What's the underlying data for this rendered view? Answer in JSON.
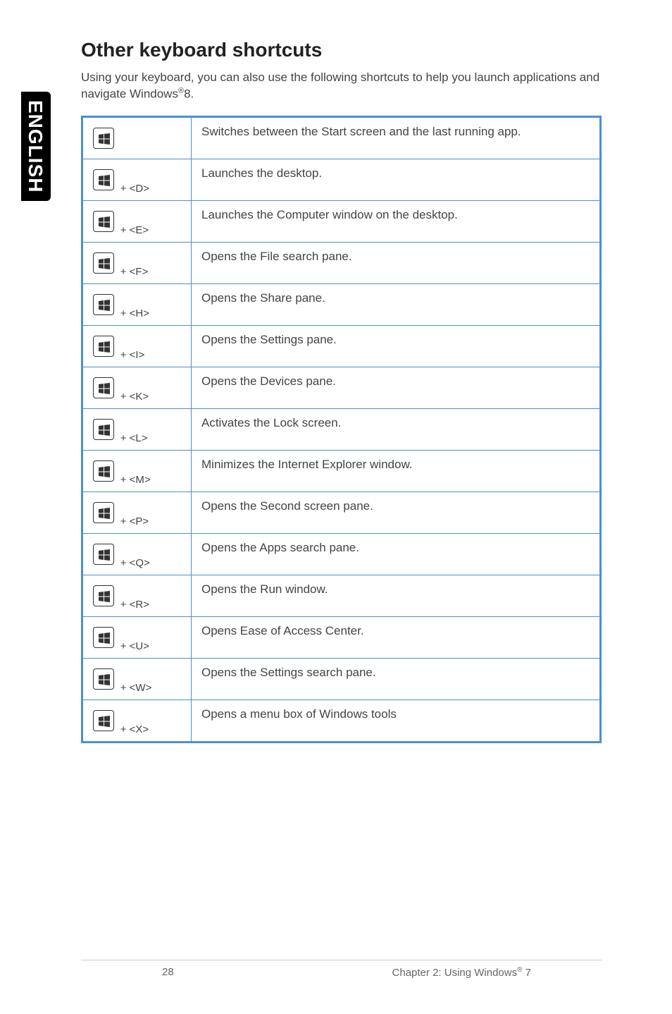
{
  "side_tab": "ENGLISH",
  "heading": "Other keyboard shortcuts",
  "intro_a": "Using your keyboard, you can also use the following shortcuts to help you launch applications and navigate Windows",
  "intro_reg": "®",
  "intro_b": "8.",
  "rows": [
    {
      "combo": "",
      "desc": "Switches between the Start screen and the last running app."
    },
    {
      "combo": "+ <D>",
      "desc": "Launches the desktop."
    },
    {
      "combo": "+ <E>",
      "desc": "Launches the Computer window on the desktop."
    },
    {
      "combo": "+ <F>",
      "desc": "Opens the File search pane."
    },
    {
      "combo": "+ <H>",
      "desc": "Opens the Share pane."
    },
    {
      "combo": "+ <I>",
      "desc": "Opens the Settings pane."
    },
    {
      "combo": "+ <K>",
      "desc": "Opens the Devices pane."
    },
    {
      "combo": "+ <L>",
      "desc": "Activates the Lock screen."
    },
    {
      "combo": "+ <M>",
      "desc": "Minimizes the Internet Explorer window."
    },
    {
      "combo": "+ <P>",
      "desc": "Opens the Second screen pane."
    },
    {
      "combo": "+ <Q>",
      "desc": "Opens the Apps search pane."
    },
    {
      "combo": "+ <R>",
      "desc": "Opens the Run window."
    },
    {
      "combo": "+ <U>",
      "desc": "Opens Ease of Access Center."
    },
    {
      "combo": "+ <W>",
      "desc": "Opens the Settings search pane."
    },
    {
      "combo": "+ <X>",
      "desc": "Opens a menu box of Windows tools"
    }
  ],
  "footer": {
    "page_num": "28",
    "chapter_a": "Chapter 2: Using Windows",
    "chapter_reg": "®",
    "chapter_b": " 7"
  }
}
